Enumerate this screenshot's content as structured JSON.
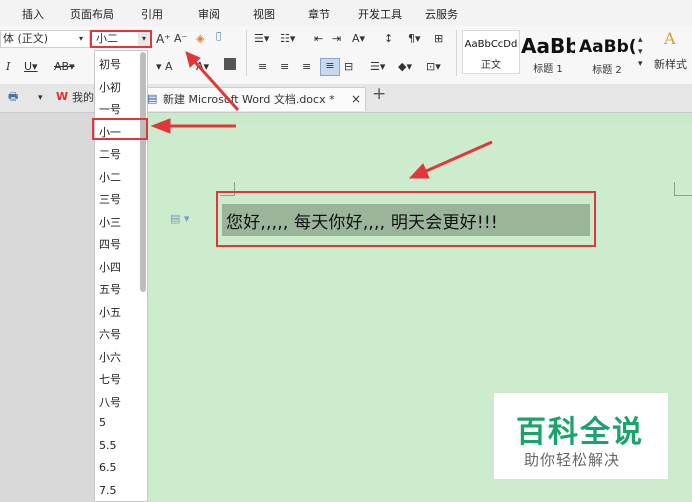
{
  "menu": {
    "tabs": [
      "插入",
      "页面布局",
      "引用",
      "审阅",
      "视图",
      "章节",
      "开发工具",
      "云服务"
    ]
  },
  "ribbon": {
    "font_name": "体 (正文)",
    "font_size": "小二",
    "styles": [
      {
        "preview": "AaBbCcDd",
        "label": "正文"
      },
      {
        "preview": "AaBb",
        "label": "标题 1"
      },
      {
        "preview": "AaBb(",
        "label": "标题 2"
      }
    ],
    "new_style": "新样式",
    "new_style_glyph": "A"
  },
  "tabbar": {
    "my_label": "我的",
    "doc_title": "新建 Microsoft Word 文档.docx *",
    "close_glyph": "×",
    "add_glyph": "+"
  },
  "font_size_list": {
    "items": [
      "初号",
      "小初",
      "一号",
      "小一",
      "二号",
      "小二",
      "三号",
      "小三",
      "四号",
      "小四",
      "五号",
      "小五",
      "六号",
      "小六",
      "七号",
      "八号",
      "5",
      "5.5",
      "6.5",
      "7.5"
    ],
    "highlighted": "小一"
  },
  "document": {
    "selected_text": "您好,,,,, 每天你好,,,, 明天会更好!!!"
  },
  "watermark": {
    "title": "百科全说",
    "subtitle": "助你轻松解决"
  },
  "colors": {
    "accent_red": "#e0373a",
    "page_green": "#cdeccd",
    "selection": "#9bb59b",
    "watermark_green": "#1aa36b"
  }
}
